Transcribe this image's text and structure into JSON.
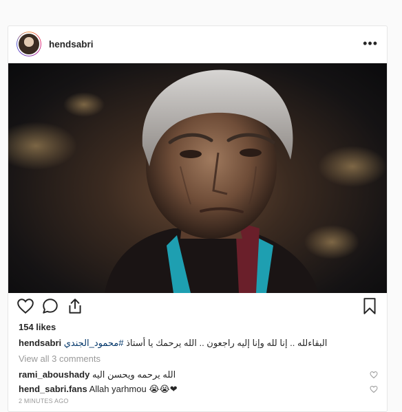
{
  "post": {
    "username": "hendsabri",
    "more_label": "•••",
    "likes": "154 likes",
    "caption": {
      "username": "hendsabri",
      "text": "البقاءلله .. إنا لله وإنا إليه راجعون .. الله يرحمك يا أستاذ",
      "hashtag": "#محمود_الجندي"
    },
    "view_all": "View all 3 comments",
    "comments": [
      {
        "username": "rami_aboushady",
        "text": "الله يرحمه ويحسن اليه"
      },
      {
        "username": "hend_sabri.fans",
        "text": "Allah yarhmou 😭😭❤"
      }
    ],
    "timestamp": "2 MINUTES AGO"
  },
  "icons": [
    "heart-icon",
    "comment-icon",
    "share-icon",
    "bookmark-icon",
    "more-options-icon"
  ],
  "colors": {
    "text": "#262626",
    "muted": "#999999",
    "hashtag": "#003569",
    "border": "#e6e6e6",
    "background": "#fafafa"
  }
}
